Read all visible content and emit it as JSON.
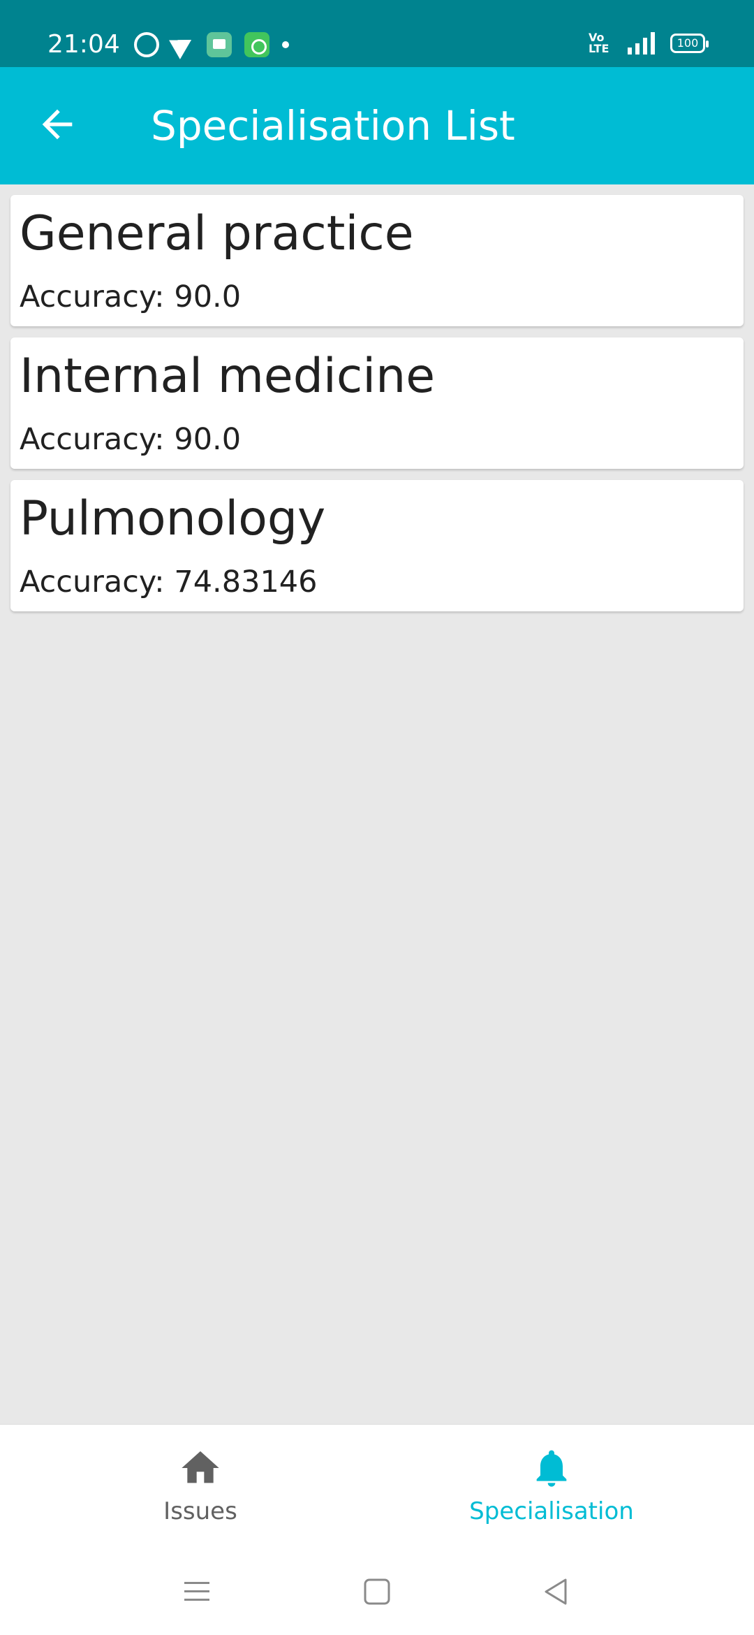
{
  "status_bar": {
    "time": "21:04",
    "network": "4G",
    "volte": "Vo LTE",
    "battery": "100"
  },
  "app_bar": {
    "title": "Specialisation List",
    "back_icon": "arrow-back-icon"
  },
  "specialisations": [
    {
      "name": "General practice",
      "accuracy": "Accuracy: 90.0"
    },
    {
      "name": "Internal medicine",
      "accuracy": "Accuracy: 90.0"
    },
    {
      "name": "Pulmonology",
      "accuracy": "Accuracy: 74.83146"
    }
  ],
  "bottom_nav": {
    "items": [
      {
        "label": "Issues",
        "icon": "home-icon",
        "active": false
      },
      {
        "label": "Specialisation",
        "icon": "bell-icon",
        "active": true
      }
    ]
  },
  "colors": {
    "status_bar": "#00838f",
    "app_bar": "#00bcd4",
    "accent": "#00bcd4",
    "background": "#e8e8e8"
  }
}
